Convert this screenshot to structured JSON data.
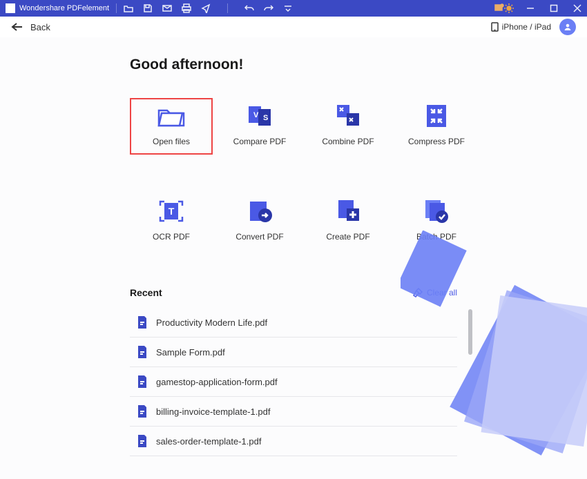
{
  "app": {
    "title": "Wondershare PDFelement"
  },
  "subbar": {
    "back": "Back",
    "device": "iPhone / iPad"
  },
  "greeting": "Good afternoon!",
  "actions": [
    {
      "label": "Open files"
    },
    {
      "label": "Compare PDF"
    },
    {
      "label": "Combine PDF"
    },
    {
      "label": "Compress PDF"
    },
    {
      "label": "OCR PDF"
    },
    {
      "label": "Convert PDF"
    },
    {
      "label": "Create PDF"
    },
    {
      "label": "Batch PDF"
    }
  ],
  "recent": {
    "title": "Recent",
    "clear": "Clear all",
    "items": [
      {
        "name": "Productivity Modern Life.pdf"
      },
      {
        "name": "Sample Form.pdf"
      },
      {
        "name": "gamestop-application-form.pdf"
      },
      {
        "name": "billing-invoice-template-1.pdf"
      },
      {
        "name": "sales-order-template-1.pdf"
      }
    ]
  },
  "colors": {
    "brand": "#3b49c4",
    "accent": "#4a59e5",
    "highlight": "#e44"
  }
}
